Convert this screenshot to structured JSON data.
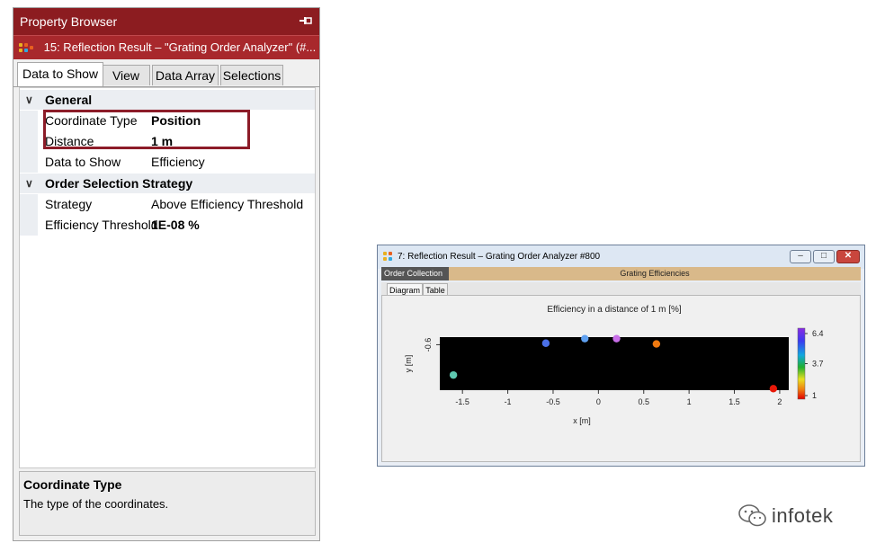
{
  "property_browser": {
    "title": "Property Browser",
    "pin_icon": "pin-icon",
    "subtitle": "15: Reflection Result – \"Grating Order Analyzer\" (#...",
    "tabs": [
      "Data to Show",
      "View",
      "Data Array",
      "Selections"
    ],
    "active_tab": "Data to Show",
    "categories": [
      {
        "name": "General",
        "rows": [
          {
            "key": "Coordinate Type",
            "value": "Position"
          },
          {
            "key": "Distance",
            "value": "1 m"
          },
          {
            "key": "Data to Show",
            "value": "Efficiency"
          }
        ]
      },
      {
        "name": "Order Selection Strategy",
        "rows": [
          {
            "key": "Strategy",
            "value": "Above Efficiency Threshold"
          },
          {
            "key": "Efficiency Threshold",
            "value": "1E-08 %"
          }
        ]
      }
    ],
    "description": {
      "title": "Coordinate Type",
      "text": "The type of the coordinates."
    },
    "colors": {
      "header": "#8c1c20",
      "subheader": "#a8282c",
      "highlight": "#8c1c28"
    }
  },
  "result_window": {
    "title": "7: Reflection Result – Grating Order Analyzer #800",
    "window_buttons": [
      "minimize-icon",
      "maximize-icon",
      "close-icon"
    ],
    "order_collection": "Order Collection",
    "grating_efficiencies": "Grating Efficiencies",
    "tabs": [
      "Diagram",
      "Table"
    ],
    "active_tab": "Diagram"
  },
  "watermark": {
    "text": "infotek",
    "icon": "wechat-icon"
  },
  "chart_data": {
    "type": "scatter",
    "title": "Efficiency in a distance of 1 m  [%]",
    "xlabel": "x [m]",
    "ylabel": "y [m]",
    "xlim": [
      -1.75,
      2.1
    ],
    "ylim": [
      -0.9,
      -0.55
    ],
    "x_ticks": [
      "-1.5",
      "-1",
      "-0.5",
      "0",
      "0.5",
      "1",
      "1.5",
      "2"
    ],
    "x_tick_values": [
      -1.5,
      -1,
      -0.5,
      0,
      0.5,
      1,
      1.5,
      2
    ],
    "y_ticks": [
      "-0.6"
    ],
    "y_tick_values": [
      -0.6
    ],
    "colorbar": {
      "ticks": [
        "6.4",
        "3.7",
        "1"
      ],
      "min": 1,
      "max": 6.4
    },
    "background": "#000000",
    "points": [
      {
        "x": -1.6,
        "y": -0.8,
        "value": 3.5,
        "color": "#5ec8b0"
      },
      {
        "x": -0.58,
        "y": -0.59,
        "value": 6.0,
        "color": "#4a70e8"
      },
      {
        "x": -0.15,
        "y": -0.56,
        "value": 5.6,
        "color": "#5fa0f0"
      },
      {
        "x": 0.2,
        "y": -0.56,
        "value": 6.3,
        "color": "#c86ee8"
      },
      {
        "x": 0.64,
        "y": -0.595,
        "value": 1.9,
        "color": "#f07a10"
      },
      {
        "x": 1.93,
        "y": -0.89,
        "value": 1.0,
        "color": "#e81808"
      }
    ]
  }
}
